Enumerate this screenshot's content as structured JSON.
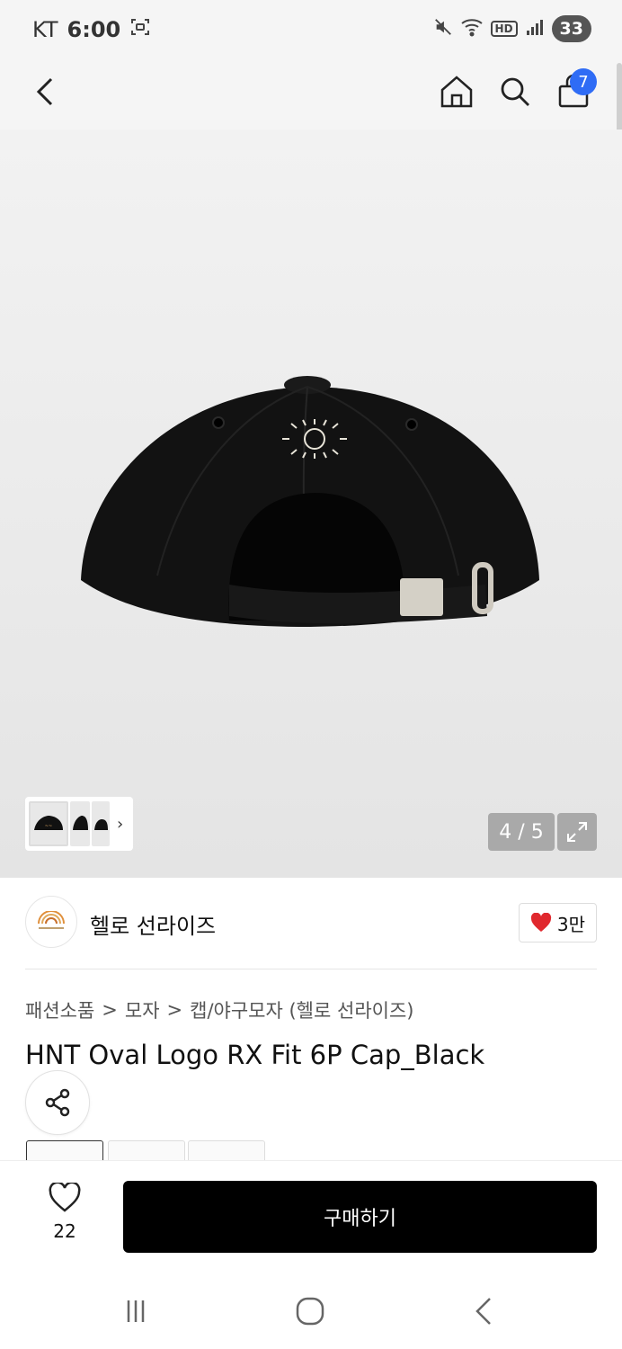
{
  "status_bar": {
    "carrier": "KT",
    "time": "6:00",
    "network": "HD",
    "battery": "33",
    "icons": [
      "screenshot-icon",
      "mute-icon",
      "wifi-icon",
      "signal-icon"
    ]
  },
  "nav": {
    "cart_count": "7",
    "icons": [
      "back-icon",
      "home-icon",
      "search-icon",
      "shopping-bag-icon"
    ]
  },
  "gallery": {
    "current": "4 / 5",
    "thumb_arrow": "›"
  },
  "brand": {
    "name": "헬로 선라이즈",
    "likes": "3만"
  },
  "breadcrumb": {
    "items": [
      "패션소품",
      "모자",
      "캡/야구모자 (헬로 선라이즈)"
    ],
    "separator": ">"
  },
  "product": {
    "title": "HNT Oval Logo RX Fit 6P Cap_Black"
  },
  "bottom_bar": {
    "wish_count": "22",
    "buy_label": "구매하기"
  },
  "colors": {
    "accent_badge": "#2f6cf5",
    "heart": "#e0282e",
    "buy_button": "#000000"
  }
}
